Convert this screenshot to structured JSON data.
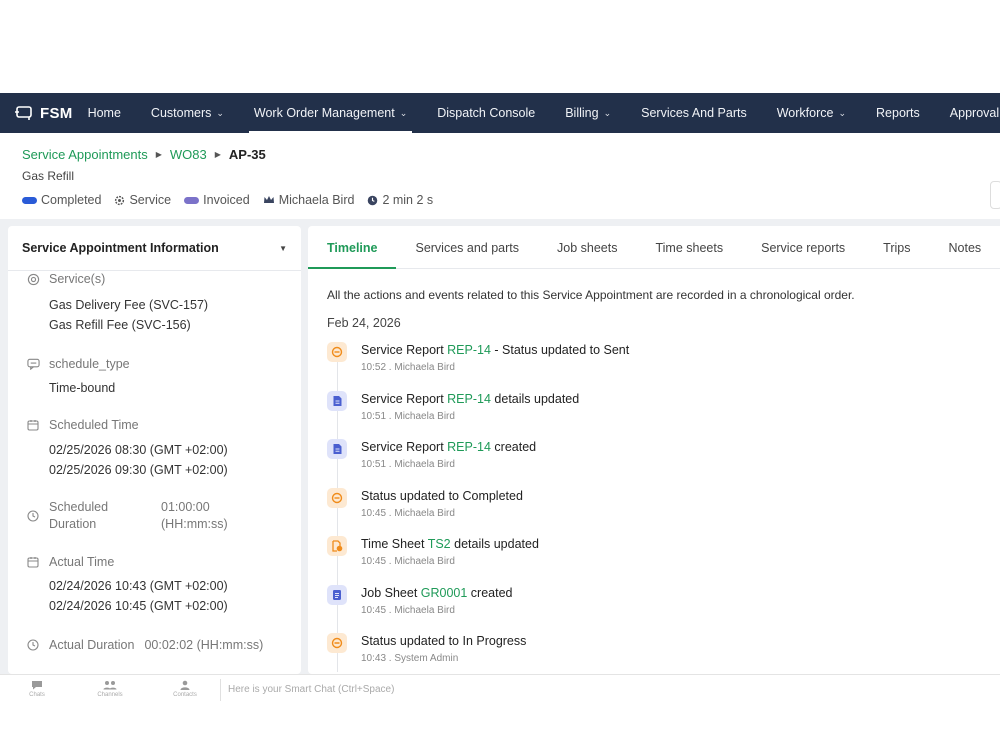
{
  "app": {
    "name": "FSM"
  },
  "nav": {
    "items": [
      {
        "label": "Home",
        "dropdown": false,
        "active": false
      },
      {
        "label": "Customers",
        "dropdown": true,
        "active": false
      },
      {
        "label": "Work Order Management",
        "dropdown": true,
        "active": true
      },
      {
        "label": "Dispatch Console",
        "dropdown": false,
        "active": false
      },
      {
        "label": "Billing",
        "dropdown": true,
        "active": false
      },
      {
        "label": "Services And Parts",
        "dropdown": false,
        "active": false
      },
      {
        "label": "Workforce",
        "dropdown": true,
        "active": false
      },
      {
        "label": "Reports",
        "dropdown": false,
        "active": false
      },
      {
        "label": "Approval Tasks",
        "dropdown": false,
        "active": false
      }
    ]
  },
  "breadcrumb": {
    "level1": "Service Appointments",
    "level2": "WO83",
    "current": "AP-35"
  },
  "record": {
    "subtitle": "Gas Refill"
  },
  "status_row": {
    "completed": "Completed",
    "service": "Service",
    "invoiced": "Invoiced",
    "owner": "Michaela Bird",
    "duration": "2 min 2 s",
    "colors": {
      "completed": "#2a5bd7",
      "invoiced": "#7b72c9"
    }
  },
  "info_panel": {
    "title": "Service Appointment Information",
    "services_label": "Service(s)",
    "services": [
      "Gas Delivery Fee (SVC-157)",
      "Gas Refill Fee (SVC-156)"
    ],
    "schedule_type_label": "schedule_type",
    "schedule_type_value": "Time-bound",
    "scheduled_time_label": "Scheduled Time",
    "scheduled_start": "02/25/2026 08:30 (GMT +02:00)",
    "scheduled_end": "02/25/2026 09:30 (GMT +02:00)",
    "scheduled_duration_label_1": "Scheduled",
    "scheduled_duration_label_2": "Duration",
    "scheduled_duration_value_1": "01:00:00",
    "scheduled_duration_value_2": "(HH:mm:ss)",
    "actual_time_label": "Actual Time",
    "actual_start": "02/24/2026 10:43 (GMT +02:00)",
    "actual_end": "02/24/2026 10:45 (GMT +02:00)",
    "actual_duration_label": "Actual Duration",
    "actual_duration_value": "00:02:02 (HH:mm:ss)"
  },
  "tabs": {
    "timeline": "Timeline",
    "services_parts": "Services and parts",
    "job_sheets": "Job sheets",
    "time_sheets": "Time sheets",
    "service_reports": "Service reports",
    "trips": "Trips",
    "notes": "Notes"
  },
  "timeline": {
    "intro": "All the actions and events related to this Service Appointment are recorded in a chronological order.",
    "date": "Feb 24, 2026",
    "events": [
      {
        "icon": "status-icon",
        "pre": "Service Report ",
        "ref": "REP-14",
        "post": " - Status updated to Sent",
        "meta": "10:52 . Michaela Bird"
      },
      {
        "icon": "report-icon",
        "pre": "Service Report ",
        "ref": "REP-14",
        "post": " details updated",
        "meta": "10:51 . Michaela Bird"
      },
      {
        "icon": "report-icon",
        "pre": "Service Report ",
        "ref": "REP-14",
        "post": " created",
        "meta": "10:51 . Michaela Bird"
      },
      {
        "icon": "status-icon",
        "pre": "Status updated to Completed",
        "ref": "",
        "post": "",
        "meta": "10:45 . Michaela Bird"
      },
      {
        "icon": "timesheet-icon",
        "pre": "Time Sheet ",
        "ref": "TS2",
        "post": " details updated",
        "meta": "10:45 . Michaela Bird"
      },
      {
        "icon": "jobsheet-icon",
        "pre": "Job Sheet ",
        "ref": "GR0001",
        "post": " created",
        "meta": "10:45 . Michaela Bird"
      },
      {
        "icon": "status-icon",
        "pre": "Status updated to In Progress",
        "ref": "",
        "post": "",
        "meta": "10:43 . System Admin"
      }
    ]
  },
  "footer": {
    "chats": "Chats",
    "channels": "Channels",
    "contacts": "Contacts",
    "smart_chat_placeholder": "Here is your Smart Chat (Ctrl+Space)"
  }
}
